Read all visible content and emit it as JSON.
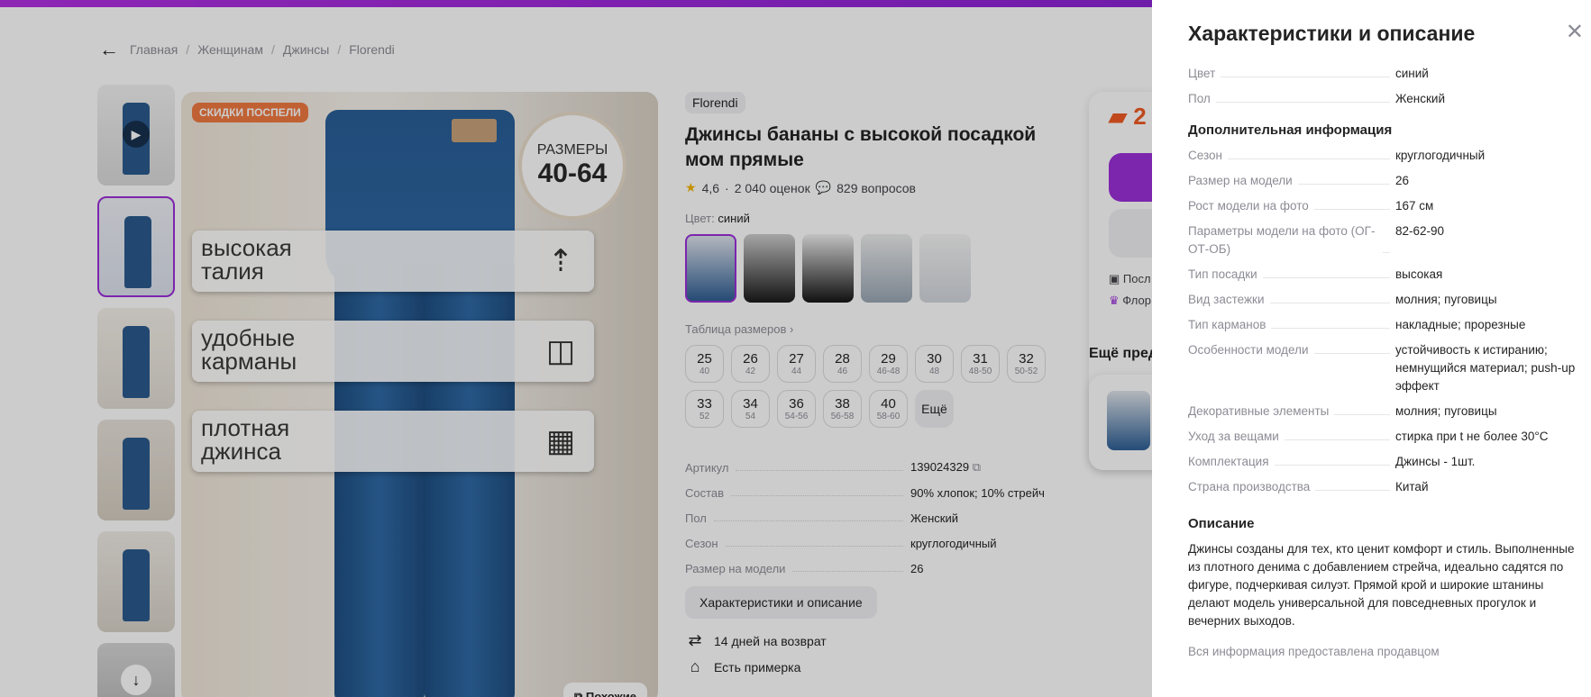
{
  "breadcrumbs": [
    "Главная",
    "Женщинам",
    "Джинсы",
    "Florendi"
  ],
  "gallery": {
    "sale_badge": "СКИДКИ ПОСПЕЛИ",
    "size_badge_line1": "РАЗМЕРЫ",
    "size_badge_line2": "40-64",
    "features": [
      "высокая\nталия",
      "удобные\nкарманы",
      "плотная\nджинса"
    ],
    "similar_label": "Похожие"
  },
  "product": {
    "brand": "Florendi",
    "title": "Джинсы бананы с высокой посадкой мом прямые",
    "rating": "4,6",
    "reviews": "2 040 оценок",
    "questions": "829 вопросов",
    "color_label": "Цвет:",
    "color_value": "синий",
    "size_table_label": "Таблица размеров",
    "sizes": [
      {
        "n": "25",
        "r": "40"
      },
      {
        "n": "26",
        "r": "42"
      },
      {
        "n": "27",
        "r": "44"
      },
      {
        "n": "28",
        "r": "46"
      },
      {
        "n": "29",
        "r": "46-48"
      },
      {
        "n": "30",
        "r": "48"
      },
      {
        "n": "31",
        "r": "48-50"
      },
      {
        "n": "32",
        "r": "50-52"
      },
      {
        "n": "33",
        "r": "52"
      },
      {
        "n": "34",
        "r": "54"
      },
      {
        "n": "36",
        "r": "54-56"
      },
      {
        "n": "38",
        "r": "56-58"
      },
      {
        "n": "40",
        "r": "58-60"
      }
    ],
    "sizes_more": "Ещё",
    "specs": [
      {
        "k": "Артикул",
        "v": "139024329"
      },
      {
        "k": "Состав",
        "v": "90% хлопок; 10% стрейч"
      },
      {
        "k": "Пол",
        "v": "Женский"
      },
      {
        "k": "Сезон",
        "v": "круглогодичный"
      },
      {
        "k": "Размер на модели",
        "v": "26"
      }
    ],
    "chars_button": "Характеристики и описание",
    "perks": [
      "14 дней на возврат",
      "Есть примерка"
    ]
  },
  "side": {
    "price_partial": "2",
    "line1": "Посл",
    "line2": "Флор",
    "more_title": "Ещё пред"
  },
  "panel": {
    "title": "Характеристики и описание",
    "basic": [
      {
        "k": "Цвет",
        "v": "синий"
      },
      {
        "k": "Пол",
        "v": "Женский"
      }
    ],
    "extra_title": "Дополнительная информация",
    "extra": [
      {
        "k": "Сезон",
        "v": "круглогодичный"
      },
      {
        "k": "Размер на модели",
        "v": "26"
      },
      {
        "k": "Рост модели на фото",
        "v": "167 см"
      },
      {
        "k": "Параметры модели на фото (ОГ-ОТ-ОБ)",
        "v": "82-62-90"
      },
      {
        "k": "Тип посадки",
        "v": "высокая"
      },
      {
        "k": "Вид застежки",
        "v": "молния; пуговицы"
      },
      {
        "k": "Тип карманов",
        "v": "накладные; прорезные"
      },
      {
        "k": "Особенности модели",
        "v": "устойчивость к истиранию; немнущийся материал; push-up эффект"
      },
      {
        "k": "Декоративные элементы",
        "v": "молния; пуговицы"
      },
      {
        "k": "Уход за вещами",
        "v": "стирка при t не более 30°C"
      },
      {
        "k": "Комплектация",
        "v": "Джинсы - 1шт."
      },
      {
        "k": "Страна производства",
        "v": "Китай"
      }
    ],
    "desc_title": "Описание",
    "description": "Джинсы созданы для тех, кто ценит комфорт и стиль. Выполненные из плотного денима с добавлением стрейча, идеально садятся по фигуре, подчеркивая силуэт. Прямой крой и широкие штанины делают модель универсальной для повседневных прогулок и вечерних выходов.",
    "footer": "Вся информация предоставлена продавцом"
  },
  "colors": {
    "accent": "#9b2fd9",
    "price": "#f05a24",
    "sale": "#f07a42"
  }
}
